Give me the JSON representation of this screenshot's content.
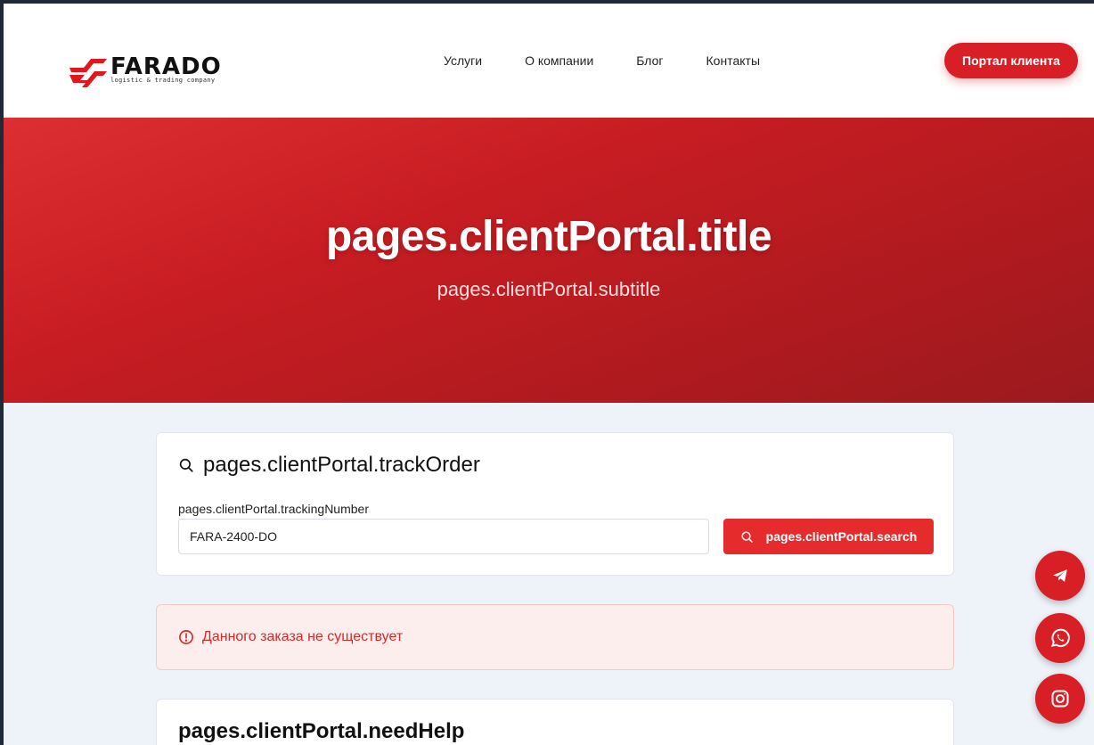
{
  "brand": {
    "name": "FARADO",
    "tagline": "logistic & trading company",
    "accent_color": "#d81f26"
  },
  "nav": {
    "items": [
      {
        "label": "Услуги"
      },
      {
        "label": "О компании"
      },
      {
        "label": "Блог"
      },
      {
        "label": "Контакты"
      }
    ],
    "portal_button": "Портал клиента"
  },
  "hero": {
    "title": "pages.clientPortal.title",
    "subtitle": "pages.clientPortal.subtitle"
  },
  "track": {
    "title": "pages.clientPortal.trackOrder",
    "field_label": "pages.clientPortal.trackingNumber",
    "input_value": "FARA-2400-DO",
    "search_button": "pages.clientPortal.search"
  },
  "alert": {
    "message": "Данного заказа не существует",
    "color": "#d42a2a"
  },
  "help": {
    "title": "pages.clientPortal.needHelp"
  },
  "social": {
    "items": [
      "telegram-icon",
      "whatsapp-icon",
      "instagram-icon"
    ]
  }
}
